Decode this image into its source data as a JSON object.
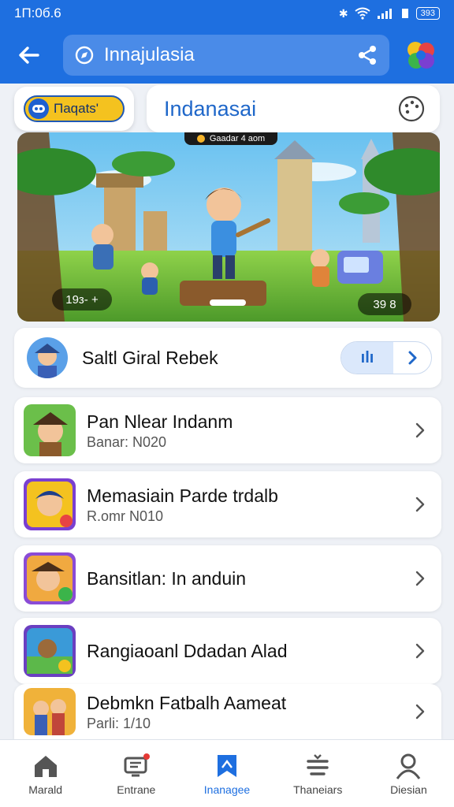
{
  "status": {
    "time": "1П:0б.6",
    "battery": "393"
  },
  "appbar": {
    "search_text": "Innajulasia"
  },
  "header": {
    "chip_label": "Пaqats'",
    "title": "Indanasai"
  },
  "banner": {
    "top_label": "Gaadar 4 aom",
    "left_badge": "19з- +",
    "right_badge": "39 8"
  },
  "featured": {
    "name": "Saltl Giral Rebek",
    "toggle_label": "ılı"
  },
  "list": [
    {
      "title": "Pan Nlear Indanm",
      "subtitle": "Banar: N020"
    },
    {
      "title": "Memasiain Parde trdalb",
      "subtitle": "R.omr N010"
    },
    {
      "title": "Bansitlan: In anduin",
      "subtitle": ""
    },
    {
      "title": "Rangiaoanl Ddadan Alad",
      "subtitle": ""
    },
    {
      "title": "Debmkn Fatbalh Aameat",
      "subtitle": "Parli:      1/10"
    }
  ],
  "nav": [
    {
      "label": "Marald",
      "icon": "home-icon"
    },
    {
      "label": "Entrane",
      "icon": "tv-icon"
    },
    {
      "label": "Inanagee",
      "icon": "bookmark-icon"
    },
    {
      "label": "Thaneiars",
      "icon": "list-icon"
    },
    {
      "label": "Diesian",
      "icon": "person-icon"
    }
  ],
  "colors": {
    "primary": "#1e6fe0",
    "accent": "#f4c21f"
  }
}
